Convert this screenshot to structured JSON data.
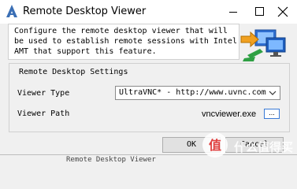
{
  "window": {
    "title": "Remote Desktop Viewer",
    "app_icon": "intel-amt-app-icon",
    "controls": [
      "minimize-icon",
      "maximize-icon",
      "close-icon"
    ]
  },
  "description": {
    "text": "Configure the remote desktop viewer that will\nbe used to establish remote sessions with Intel\nAMT that support this feature.",
    "icon": "remote-desktop-computers-icon"
  },
  "settings": {
    "group_title": "Remote Desktop Settings",
    "viewer_type_label": "Viewer Type",
    "viewer_type_value": "UltraVNC* - http://www.uvnc.com",
    "viewer_path_label": "Viewer Path",
    "viewer_path_value": "vncviewer.exe",
    "browse_label": "..."
  },
  "buttons": {
    "ok_label": "OK",
    "cancel_label": "Cancel"
  },
  "behind_window": {
    "text": "Remote Desktop Viewer"
  },
  "watermark": {
    "text": "什么值得买"
  },
  "colors": {
    "window_bg": "#f0f0f0",
    "titlebar_bg": "#ffffff",
    "focus_border": "#3a7ad6",
    "button_bg": "#e1e1e1"
  }
}
